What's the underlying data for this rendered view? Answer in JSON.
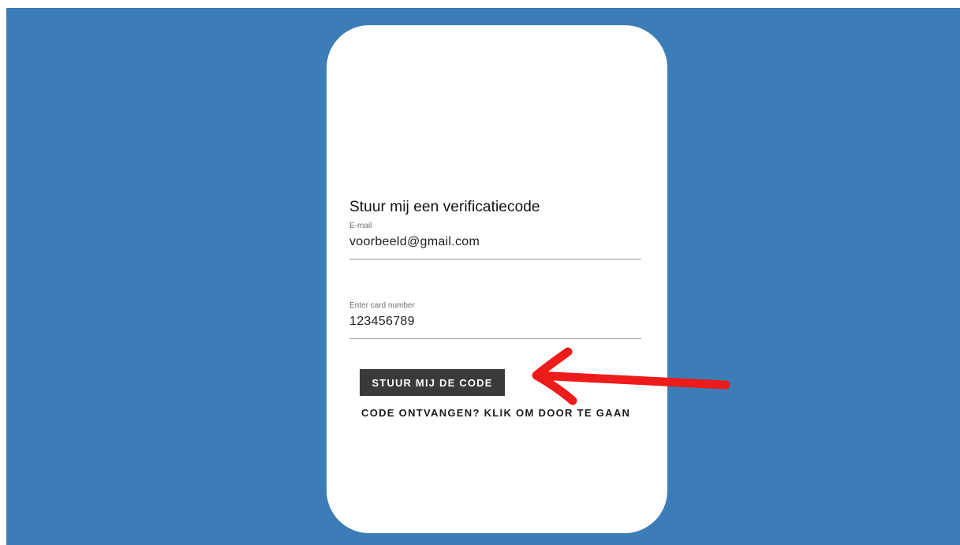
{
  "form": {
    "heading": "Stuur mij een verificatiecode",
    "email": {
      "label": "E-mail",
      "value": "voorbeeld@gmail.com"
    },
    "card_number": {
      "label": "Enter card number",
      "value": "123456789"
    },
    "send_button_label": "STUUR MIJ DE CODE",
    "continue_link_label": "CODE ONTVANGEN? KLIK OM DOOR TE GAAN"
  },
  "colors": {
    "background": "#3c7db8",
    "card": "#ffffff",
    "button": "#3a3a3a",
    "annotation_arrow": "#ee1b1b"
  },
  "annotation": {
    "icon": "red-arrow-icon"
  }
}
